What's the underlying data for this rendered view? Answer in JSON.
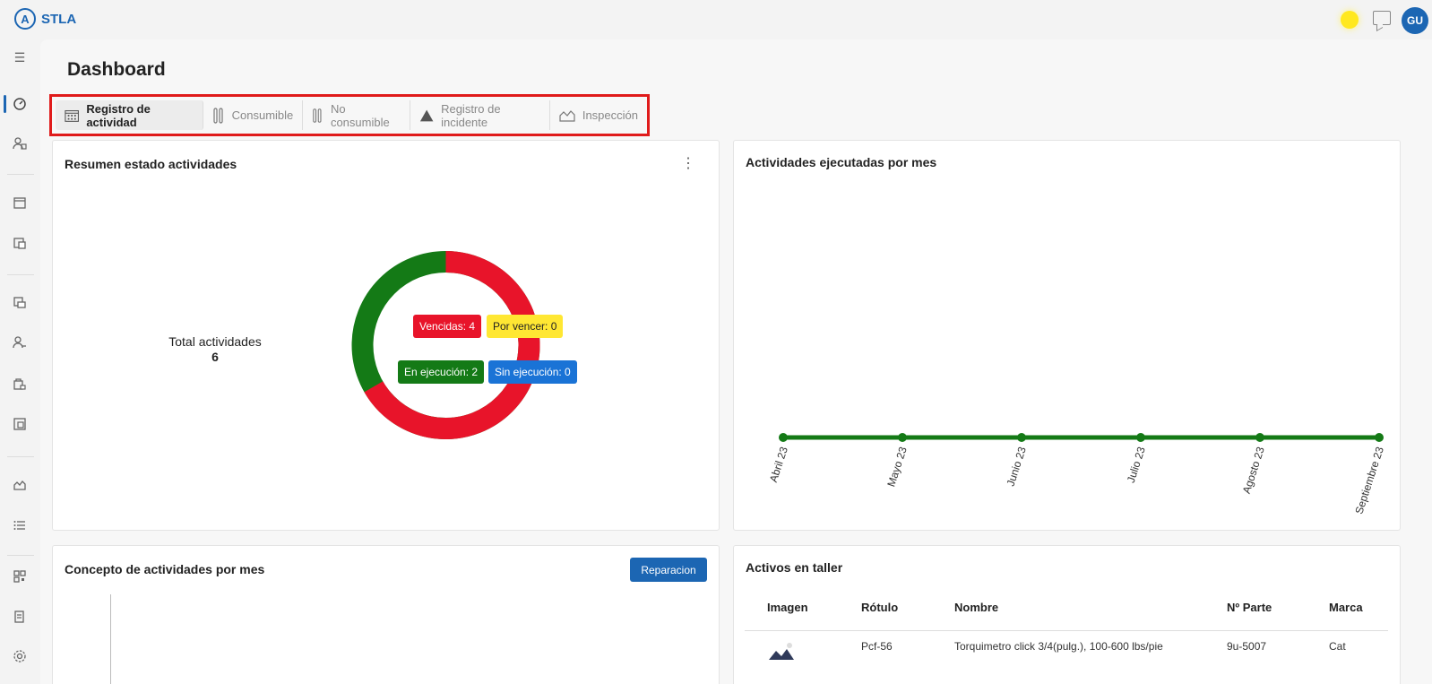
{
  "app": {
    "name": "STLA",
    "logo_letter": "A"
  },
  "header": {
    "user_initials": "GU"
  },
  "page": {
    "title": "Dashboard"
  },
  "tabs": [
    {
      "label": "Registro de actividad",
      "icon": "calendar-icon",
      "active": true
    },
    {
      "label": "Consumible",
      "icon": "tools-icon",
      "active": false
    },
    {
      "label": "No consumible",
      "icon": "tools-icon",
      "active": false
    },
    {
      "label": "Registro de incidente",
      "icon": "warning-icon",
      "active": false
    },
    {
      "label": "Inspección",
      "icon": "inspection-icon",
      "active": false
    }
  ],
  "status_card": {
    "title": "Resumen estado actividades",
    "center_label": "Total actividades",
    "total": "6",
    "badges": {
      "vencidas": "Vencidas: 4",
      "por_vencer": "Por vencer: 0",
      "en_ejecucion": "En ejecución: 2",
      "sin_ejecucion": "Sin ejecución: 0"
    },
    "colors": {
      "red": "#e8142a",
      "green": "#147a16",
      "yellow": "#ffe733",
      "blue": "#1a73d6"
    }
  },
  "monthly_card": {
    "title": "Actividades ejecutadas por mes"
  },
  "concept_card": {
    "title": "Concepto de actividades por mes",
    "button": "Reparacion"
  },
  "assets_card": {
    "title": "Activos en taller",
    "columns": [
      "Imagen",
      "Rótulo",
      "Nombre",
      "Nº Parte",
      "Marca"
    ],
    "rows": [
      {
        "rotulo": "Pcf-56",
        "nombre": "Torquimetro click 3/4(pulg.), 100-600 lbs/pie",
        "parte": "9u-5007",
        "marca": "Cat"
      }
    ]
  },
  "chart_data": [
    {
      "type": "pie",
      "title": "Resumen estado actividades",
      "categories": [
        "Vencidas",
        "En ejecución"
      ],
      "values": [
        4,
        2
      ],
      "colors": [
        "#e8142a",
        "#147a16"
      ]
    },
    {
      "type": "line",
      "title": "Actividades ejecutadas por mes",
      "categories": [
        "Abril 23",
        "Mayo 23",
        "Junio 23",
        "Julio 23",
        "Agosto 23",
        "Septiembre 23"
      ],
      "values": [
        0,
        0,
        0,
        0,
        0,
        0
      ],
      "color": "#147a16"
    }
  ]
}
